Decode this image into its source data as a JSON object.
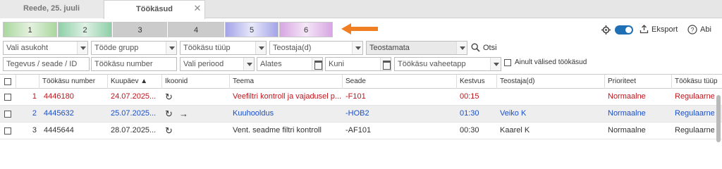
{
  "tabs": [
    {
      "label": "Reede, 25. juuli"
    },
    {
      "label": "Töökäsud",
      "close": "✕"
    }
  ],
  "priority_buttons": [
    {
      "label": "1",
      "color": "#b8dcb0"
    },
    {
      "label": "2",
      "color": "#9fd4b4"
    },
    {
      "label": "3",
      "color": "#c9c9c9"
    },
    {
      "label": "4",
      "color": "#c9c9c9"
    },
    {
      "label": "5",
      "color": "#b3b3ec"
    },
    {
      "label": "6",
      "color": "#dcb3e3"
    }
  ],
  "toolbar": {
    "export_label": "Eksport",
    "help_label": "Abi"
  },
  "filters": {
    "row1": {
      "location": "Vali asukoht",
      "product_group": "Tööde grupp",
      "order_type": "Töökäsu tüüp",
      "performer": "Teostaja(d)",
      "status": "Teostamata",
      "search_label": "Otsi"
    },
    "row2": {
      "activity": "Tegevus / seade / ID",
      "order_number": "Töökäsu number",
      "period": "Vali periood",
      "from": "Alates",
      "to": "Kuni",
      "stage": "Töökäsu vaheetapp",
      "external_only": "Ainult välised töökäsud"
    }
  },
  "table": {
    "headers": [
      "Töökäsu number",
      "Kuupäev ▲",
      "Ikoonid",
      "Teema",
      "Seade",
      "Kestvus",
      "Teostaja(d)",
      "Prioriteet",
      "Töökäsu tüüp"
    ],
    "rows": [
      {
        "n": "1",
        "number": "4446180",
        "date": "24.07.2025...",
        "icons": "↻",
        "arrow": "",
        "topic": "Veefiltri kontroll ja vajadusel p...",
        "device": "-F101",
        "duration": "00:15",
        "performer": "",
        "priority": "Normaalne",
        "type": "Regulaarne",
        "color": "red"
      },
      {
        "n": "2",
        "number": "4445632",
        "date": "25.07.2025...",
        "icons": "↻",
        "arrow": "→",
        "topic": "Kuuhooldus",
        "device": "-HOB2",
        "duration": "01:30",
        "performer": "Veiko K",
        "priority": "Normaalne",
        "type": "Regulaarne",
        "color": "blue"
      },
      {
        "n": "3",
        "number": "4445644",
        "date": "28.07.2025...",
        "icons": "↻",
        "arrow": "",
        "topic": "Vent. seadme filtri kontroll",
        "device": "-AF101",
        "duration": "00:30",
        "performer": "Kaarel K",
        "priority": "Normaalne",
        "type": "Regulaarne",
        "color": "dark"
      }
    ]
  },
  "colors": {
    "accent": "#1f6fb5",
    "arrow": "#f07f24",
    "row_red": "#c0141b",
    "row_blue": "#1a4fc9"
  }
}
